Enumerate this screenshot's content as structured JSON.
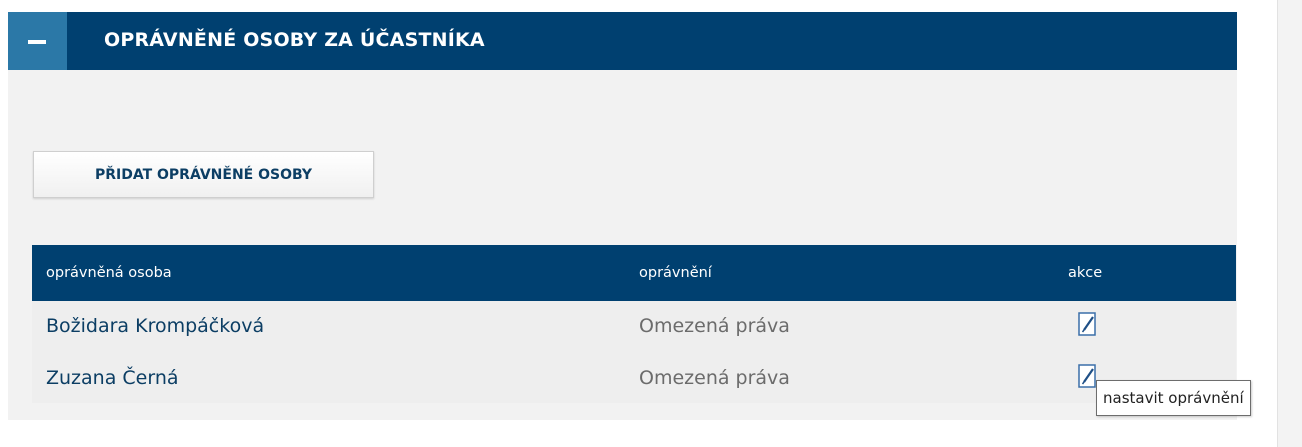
{
  "panel": {
    "title": "OPRÁVNĚNÉ OSOBY ZA ÚČASTNÍKA",
    "collapse_icon": "minus-icon",
    "add_button_label": "PŘIDAT OPRÁVNĚNÉ OSOBY"
  },
  "table": {
    "columns": [
      "oprávněná osoba",
      "oprávnění",
      "akce"
    ],
    "rows": [
      {
        "name": "Božidara Krompáčková",
        "permission": "Omezená práva",
        "action_icon": "edit-icon"
      },
      {
        "name": "Zuzana Černá",
        "permission": "Omezená práva",
        "action_icon": "edit-icon"
      }
    ]
  },
  "tooltip": {
    "text": "nastavit oprávnění"
  },
  "colors": {
    "header_bg": "#004070",
    "collapse_bg": "#2b78a7",
    "panel_bg": "#f2f2f2",
    "link_text": "#0c3e64",
    "muted_text": "#6b6b6b"
  }
}
